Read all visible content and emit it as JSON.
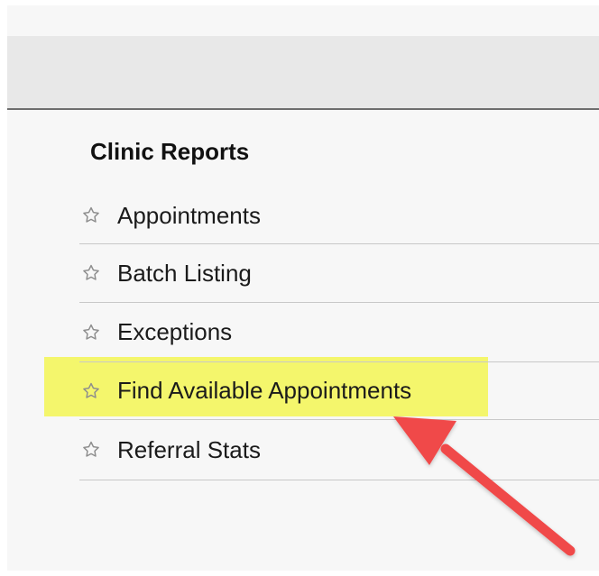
{
  "reports": {
    "title": "Clinic Reports",
    "items": [
      {
        "label": "Appointments",
        "icon": "star-outline-icon"
      },
      {
        "label": "Batch Listing",
        "icon": "star-outline-icon"
      },
      {
        "label": "Exceptions",
        "icon": "star-outline-icon"
      },
      {
        "label": "Find Available Appointments",
        "icon": "star-outline-icon"
      },
      {
        "label": "Referral Stats",
        "icon": "star-outline-icon"
      }
    ]
  },
  "annotation": {
    "highlight_color": "#f3f55f",
    "arrow_color": "#f04a4a"
  }
}
